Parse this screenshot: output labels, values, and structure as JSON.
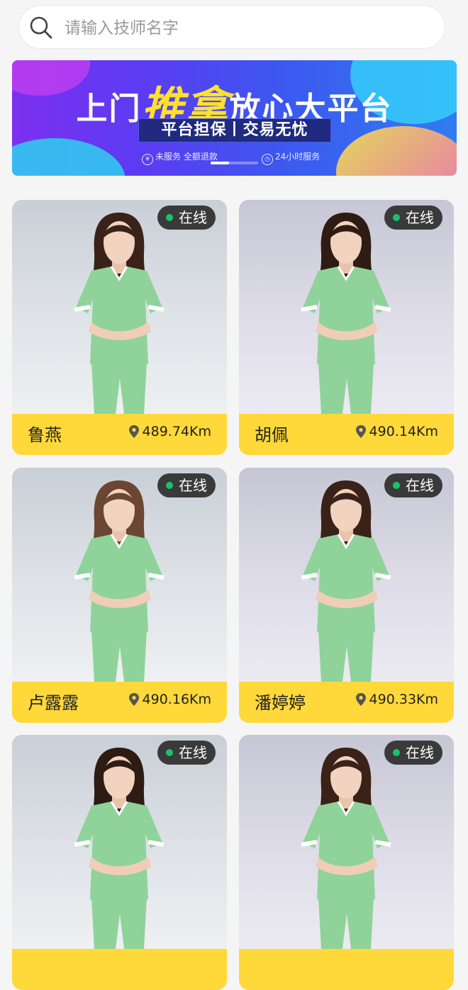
{
  "search": {
    "placeholder": "请输入技师名字"
  },
  "banner": {
    "title_pre": "上门",
    "title_hl": "推拿",
    "title_post": "放心大平台",
    "strip": "平台担保丨交易无忧",
    "feat1_icon": "¥",
    "feat1": "未服务 全额退款",
    "feat2": "24小时服务"
  },
  "technicians": [
    {
      "status": "在线",
      "name": "鲁燕",
      "distance": "489.74Km",
      "hair": "#3a2218"
    },
    {
      "status": "在线",
      "name": "胡佩",
      "distance": "490.14Km",
      "hair": "#2e1c14"
    },
    {
      "status": "在线",
      "name": "卢露露",
      "distance": "490.16Km",
      "hair": "#6b4632"
    },
    {
      "status": "在线",
      "name": "潘婷婷",
      "distance": "490.33Km",
      "hair": "#3a2218"
    },
    {
      "status": "在线",
      "name": "",
      "distance": "",
      "hair": "#2e1c14"
    },
    {
      "status": "在线",
      "name": "",
      "distance": "",
      "hair": "#3a2218"
    }
  ],
  "colors": {
    "card_footer": "#ffd83a",
    "uniform": "#8fd39a",
    "online_dot": "#19c26a"
  }
}
